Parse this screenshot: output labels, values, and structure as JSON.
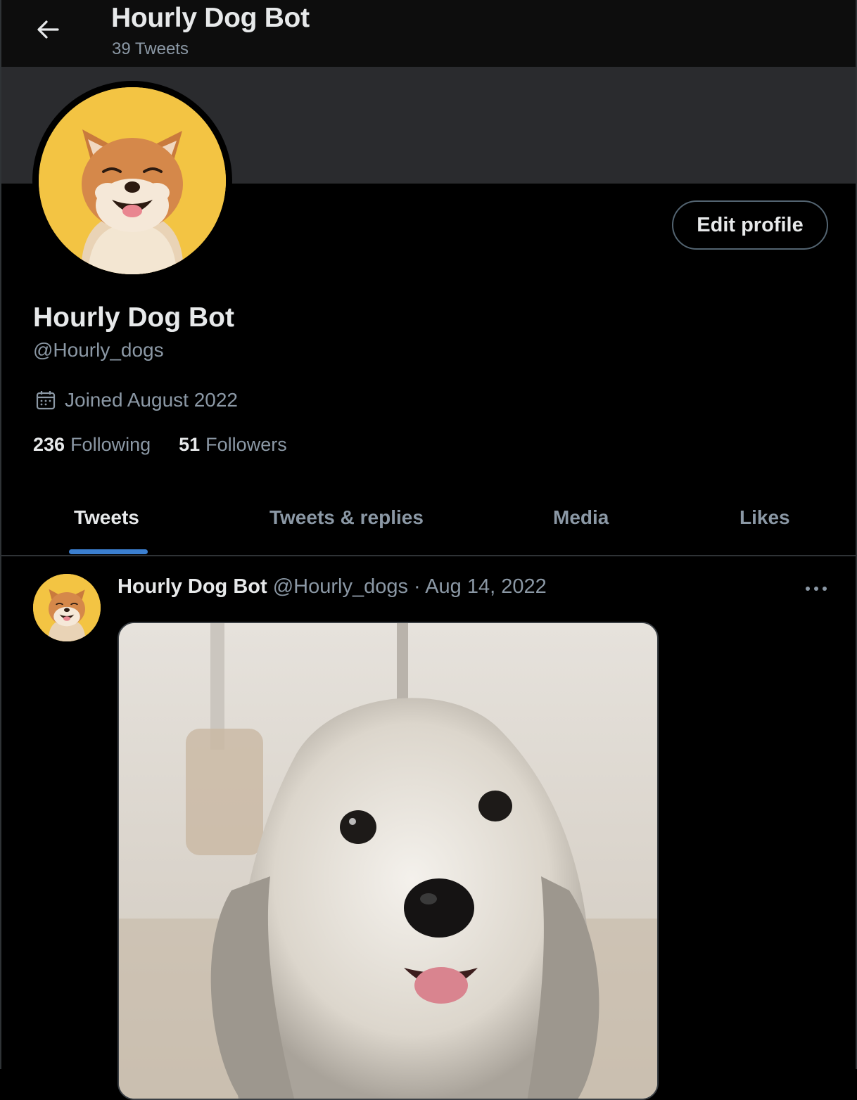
{
  "header": {
    "title": "Hourly Dog Bot",
    "tweet_count": "39 Tweets",
    "back_icon": "arrow-left-icon"
  },
  "profile": {
    "display_name": "Hourly Dog Bot",
    "handle": "@Hourly_dogs",
    "joined": "Joined August 2022",
    "edit_label": "Edit profile",
    "following_count": "236",
    "following_label": "Following",
    "followers_count": "51",
    "followers_label": "Followers",
    "avatar_bg": "#f3c443",
    "banner_color": "#2a2b2e"
  },
  "tabs": [
    {
      "label": "Tweets",
      "active": true
    },
    {
      "label": "Tweets & replies",
      "active": false
    },
    {
      "label": "Media",
      "active": false
    },
    {
      "label": "Likes",
      "active": false
    }
  ],
  "tweet": {
    "author": "Hourly Dog Bot",
    "handle": "@Hourly_dogs",
    "separator": "·",
    "date": "Aug 14, 2022",
    "more_icon": "more-horizontal-icon"
  },
  "colors": {
    "accent": "#3b7fd0",
    "text_primary": "#e7e9ea",
    "text_secondary": "#8b98a5"
  }
}
